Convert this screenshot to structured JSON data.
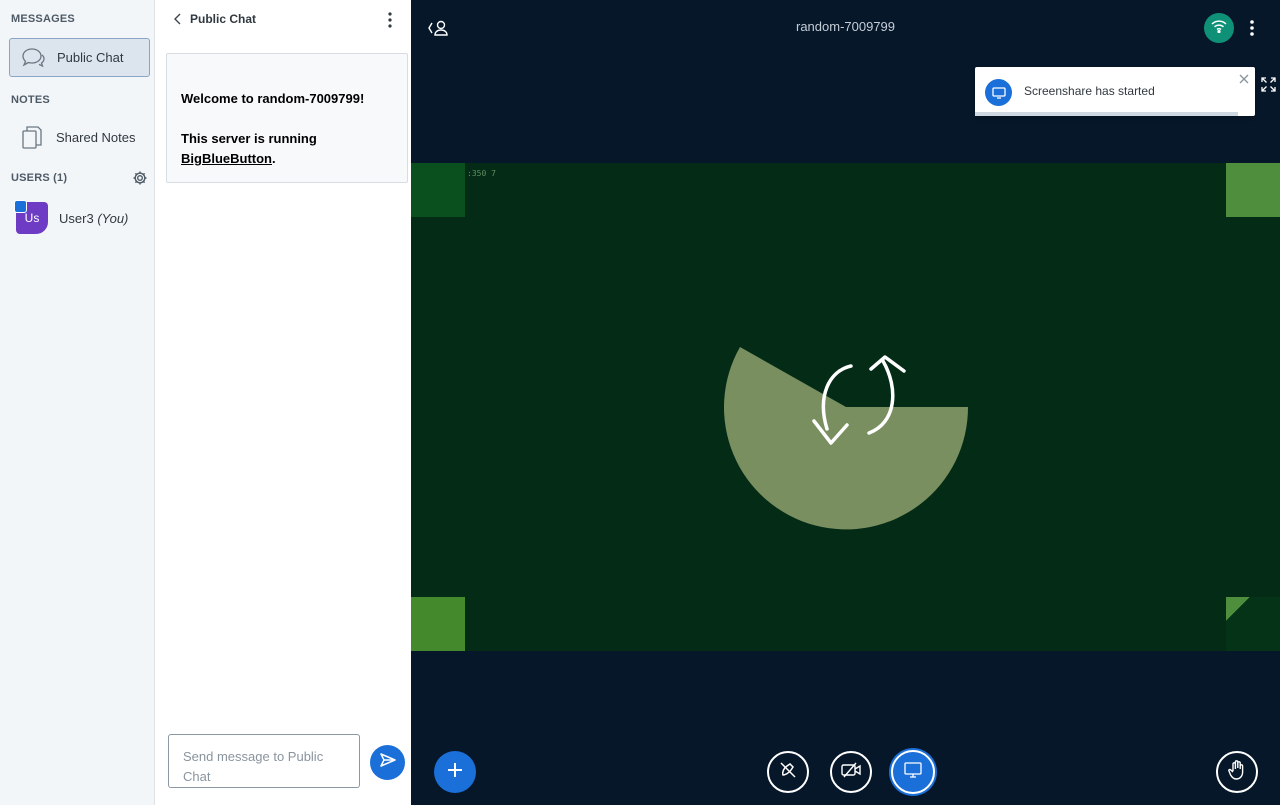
{
  "sidebar": {
    "messages_title": "MESSAGES",
    "public_chat_label": "Public Chat",
    "notes_title": "NOTES",
    "shared_notes_label": "Shared Notes",
    "users_title": "USERS (1)",
    "user": {
      "initials": "Us",
      "name": "User3",
      "you_label": "(You)"
    }
  },
  "chat": {
    "title": "Public Chat",
    "welcome_prefix": "Welcome to ",
    "meeting_name": "random-7009799",
    "welcome_suffix": "!",
    "server_line": "This server is running",
    "server_link": "BigBlueButton",
    "server_end": ".",
    "input_placeholder": "Send message to Public Chat"
  },
  "main": {
    "meeting_title": "random-7009799",
    "toast_text": "Screenshare has started",
    "toast_progress": 0.94,
    "screen_corner_text": ":350 7"
  },
  "colors": {
    "primary": "#1b6fd8",
    "main_bg": "#06172a",
    "connection_ok": "#0f9178",
    "avatar": "#6d3bc4",
    "screen_bg": "#032b16"
  },
  "icons": {
    "public_chat": "chat-bubbles-icon",
    "shared_notes": "copy-document-icon",
    "settings": "gear-icon",
    "back": "chevron-left-icon",
    "menu": "kebab-icon",
    "send": "send-icon",
    "users_toggle": "user-list-icon",
    "connection": "wifi-icon",
    "screenshare": "desktop-icon",
    "close": "close-icon",
    "fullscreen": "expand-icon",
    "actions": "plus-icon",
    "mic": "mic-off-icon",
    "camera": "camera-off-icon",
    "raise_hand": "hand-icon"
  }
}
